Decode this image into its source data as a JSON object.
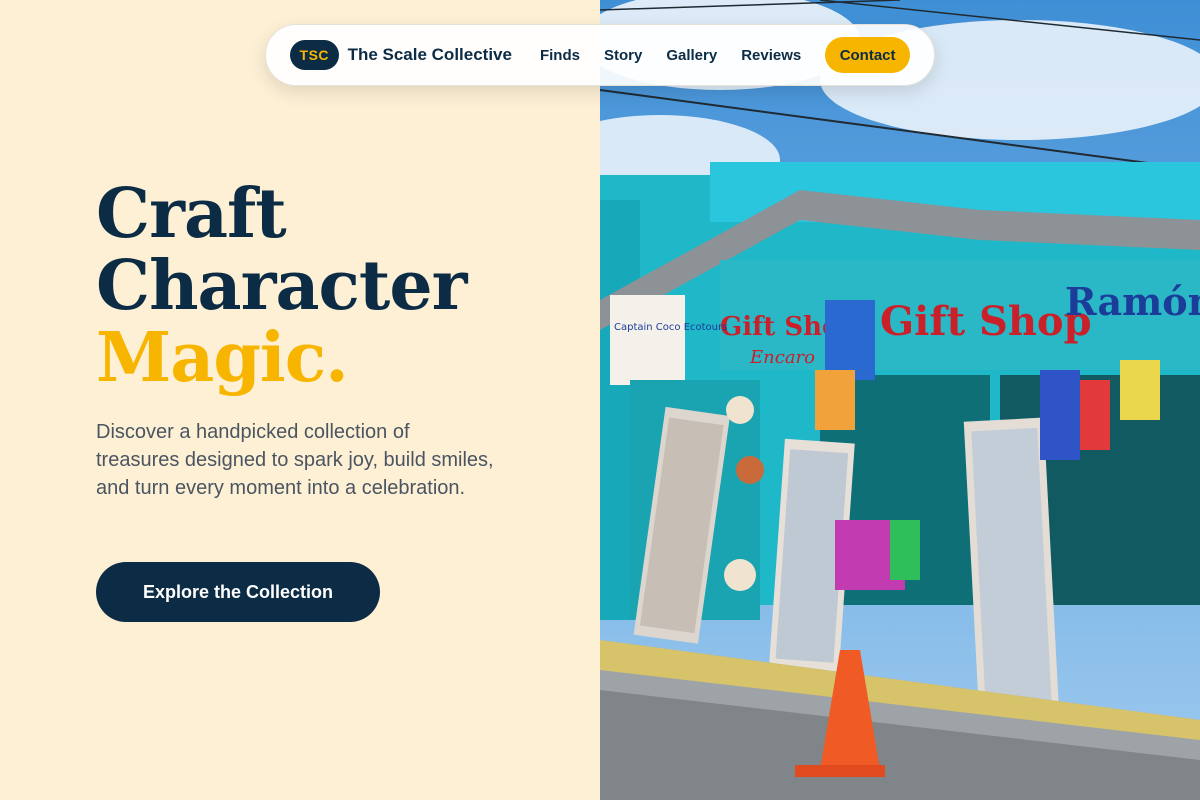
{
  "nav": {
    "badge": "TSC",
    "brand": "The Scale Collective",
    "links": [
      "Finds",
      "Story",
      "Gallery",
      "Reviews"
    ],
    "contact": "Contact"
  },
  "hero": {
    "line1": "Craft",
    "line2": "Character",
    "line3": "Magic.",
    "subtitle": "Discover a handpicked collection of treasures designed to spark joy, build smiles, and turn every moment into a celebration.",
    "cta": "Explore the Collection"
  },
  "photo": {
    "sign_main": "Gift Shop",
    "sign_left": "Gift Shop",
    "sign_left_sub": "Encaro",
    "sign_right": "Ramón",
    "sign_side": "Captain Coco Ecotours"
  },
  "colors": {
    "navy": "#0c2c45",
    "gold": "#f7b500",
    "cream": "#fdf0d5",
    "teal": "#1fb8c8"
  }
}
